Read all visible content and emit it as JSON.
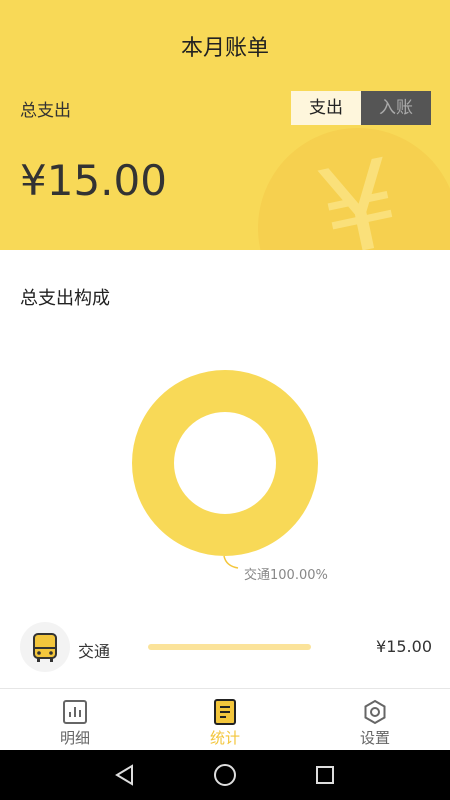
{
  "header": {
    "title": "本月账单",
    "total_label": "总支出",
    "amount": "¥15.00",
    "toggle": {
      "expense": "支出",
      "income": "入账"
    }
  },
  "breakdown": {
    "title": "总支出构成",
    "chart_label": "交通100.00%"
  },
  "chart_data": {
    "type": "pie",
    "categories": [
      "交通"
    ],
    "values": [
      100
    ],
    "title": "总支出构成"
  },
  "list": [
    {
      "icon": "bus-icon",
      "label": "交通",
      "amount": "¥15.00",
      "ratio": 1.0
    }
  ],
  "tabs": [
    {
      "label": "明细",
      "icon": "chart-icon",
      "active": false
    },
    {
      "label": "统计",
      "icon": "document-icon",
      "active": true
    },
    {
      "label": "设置",
      "icon": "gear-icon",
      "active": false
    }
  ],
  "colors": {
    "accent": "#f8d957",
    "donut": "#f8d957",
    "active_tab": "#f3c63c",
    "toggle_inactive": "#555555"
  }
}
